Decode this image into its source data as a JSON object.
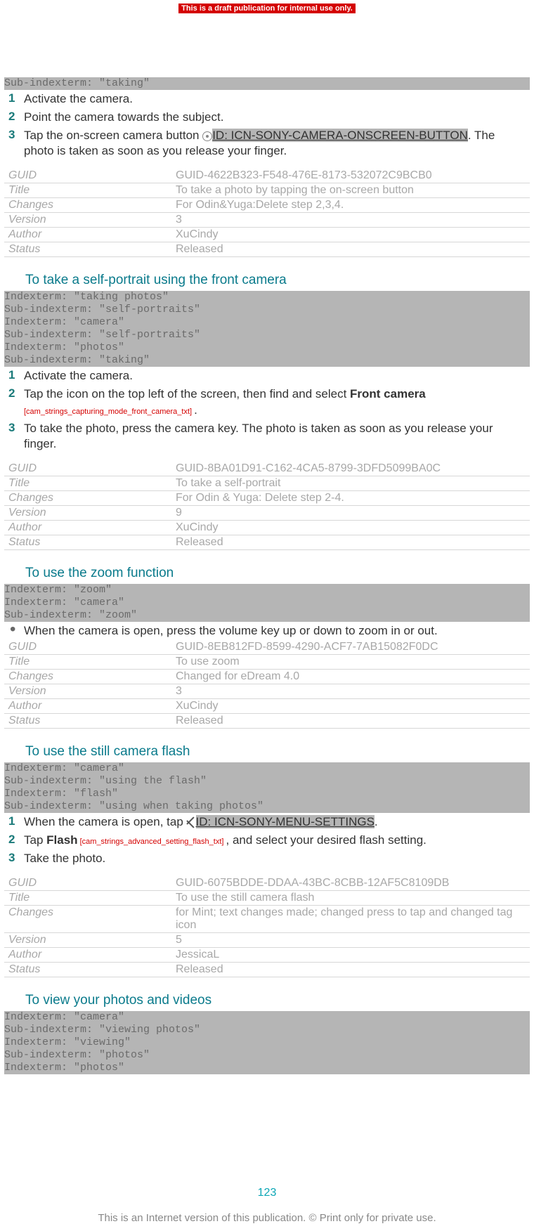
{
  "banner": "This is a draft publication for internal use only.",
  "top_indexterm": "Sub-indexterm: \"taking\"",
  "steps_a": [
    {
      "n": "1",
      "t": "Activate the camera."
    },
    {
      "n": "2",
      "t": "Point the camera towards the subject."
    }
  ],
  "step_a3_n": "3",
  "step_a3_pre": "Tap the on-screen camera button ",
  "step_a3_hl": "ID: ICN-SONY-CAMERA-ONSCREEN-BUTTON",
  "step_a3_post": ". The photo is taken as soon as you release your finger.",
  "meta_a": {
    "guid": "GUID-4622B323-F548-476E-8173-532072C9BCB0",
    "title": "To take a photo by tapping the on-screen button",
    "changes": "For Odin&Yuga:Delete step 2,3,4.",
    "version": "3",
    "author": "XuCindy",
    "status": "Released"
  },
  "heading_b": "To take a self-portrait using the front camera",
  "index_b": "Indexterm: \"taking photos\"\nSub-indexterm: \"self-portraits\"\nIndexterm: \"camera\"\nSub-indexterm: \"self-portraits\"\nIndexterm: \"photos\"\nSub-indexterm: \"taking\"",
  "steps_b1": {
    "n": "1",
    "t": "Activate the camera."
  },
  "steps_b2": {
    "n": "2",
    "pre": "Tap the icon on the top left of the screen, then find and select ",
    "bold": "Front camera",
    "tag": " [cam_strings_capturing_mode_front_camera_txt] ",
    "post": "."
  },
  "steps_b3": {
    "n": "3",
    "t": "To take the photo, press the camera key. The photo is taken as soon as you release your finger."
  },
  "meta_b": {
    "guid": "GUID-8BA01D91-C162-4CA5-8799-3DFD5099BA0C",
    "title": "To take a self-portrait",
    "changes": "For Odin & Yuga: Delete step 2-4.",
    "version": "9",
    "author": "XuCindy",
    "status": "Released"
  },
  "heading_c": "To use the zoom function",
  "index_c": "Indexterm: \"zoom\"\nIndexterm: \"camera\"\nSub-indexterm: \"zoom\"",
  "bullet_c": "When the camera is open, press the volume key up or down to zoom in or out.",
  "meta_c": {
    "guid": "GUID-8EB812FD-8599-4290-ACF7-7AB15082F0DC",
    "title": "To use zoom",
    "changes": "Changed for eDream 4.0",
    "version": "3",
    "author": "XuCindy",
    "status": "Released"
  },
  "heading_d": "To use the still camera flash",
  "index_d": "Indexterm: \"camera\"\nSub-indexterm: \"using the flash\"\nIndexterm: \"flash\"\nSub-indexterm: \"using when taking photos\"",
  "steps_d1": {
    "n": "1",
    "pre": "When the camera is open, tap ",
    "hl": "ID: ICN-SONY-MENU-SETTINGS",
    "post": "."
  },
  "steps_d2": {
    "n": "2",
    "pre": "Tap ",
    "bold": "Flash",
    "tag": " [cam_strings_advanced_setting_flash_txt] ",
    "post": ", and select your desired flash setting."
  },
  "steps_d3": {
    "n": "3",
    "t": "Take the photo."
  },
  "meta_d": {
    "guid": "GUID-6075BDDE-DDAA-43BC-8CBB-12AF5C8109DB",
    "title": "To use the still camera flash",
    "changes": "for Mint; text changes made; changed press to tap and changed tag icon",
    "version": "5",
    "author": "JessicaL",
    "status": "Released"
  },
  "heading_e": "To view your photos and videos",
  "index_e": "Indexterm: \"camera\"\nSub-indexterm: \"viewing photos\"\nIndexterm: \"viewing\"\nSub-indexterm: \"photos\"\nIndexterm: \"photos\"",
  "labels": {
    "guid": "GUID",
    "title": "Title",
    "changes": "Changes",
    "version": "Version",
    "author": "Author",
    "status": "Status"
  },
  "page_number": "123",
  "footer": "This is an Internet version of this publication. © Print only for private use."
}
